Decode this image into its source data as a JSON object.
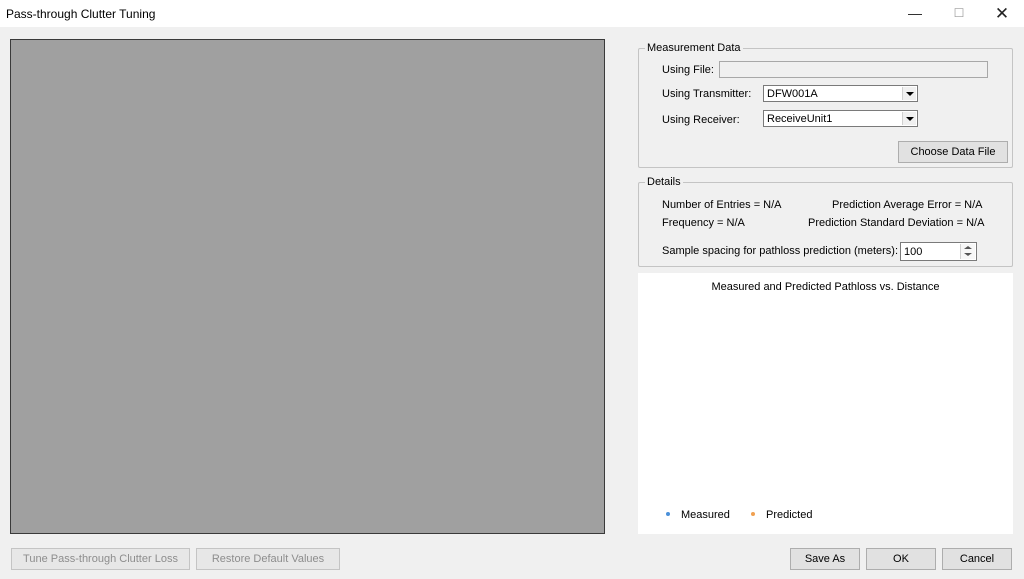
{
  "window": {
    "title": "Pass-through Clutter Tuning",
    "minimize_glyph": "—",
    "maximize_glyph": "☐",
    "close_glyph": "✕"
  },
  "measurement": {
    "legend": "Measurement Data",
    "file_label": "Using File:",
    "file_value": "",
    "transmitter_label": "Using Transmitter:",
    "transmitter_value": "DFW001A",
    "receiver_label": "Using Receiver:",
    "receiver_value": "ReceiveUnit1",
    "choose_button": "Choose Data File"
  },
  "details": {
    "legend": "Details",
    "entries": "Number of Entries = N/A",
    "avg_error": "Prediction Average Error = N/A",
    "frequency": "Frequency = N/A",
    "std_dev": "Prediction Standard Deviation = N/A",
    "spacing_label": "Sample spacing for pathloss prediction (meters):",
    "spacing_value": "100"
  },
  "chart_data": {
    "type": "scatter",
    "title": "Measured and Predicted Pathloss vs. Distance",
    "series": [
      {
        "name": "Measured",
        "color": "#4a90d9",
        "x": [],
        "y": []
      },
      {
        "name": "Predicted",
        "color": "#f0a050",
        "x": [],
        "y": []
      }
    ],
    "legend_position": "bottom-left"
  },
  "footer": {
    "tune_button": "Tune Pass-through Clutter Loss",
    "restore_button": "Restore Default Values",
    "save_as_button": "Save As",
    "ok_button": "OK",
    "cancel_button": "Cancel"
  }
}
